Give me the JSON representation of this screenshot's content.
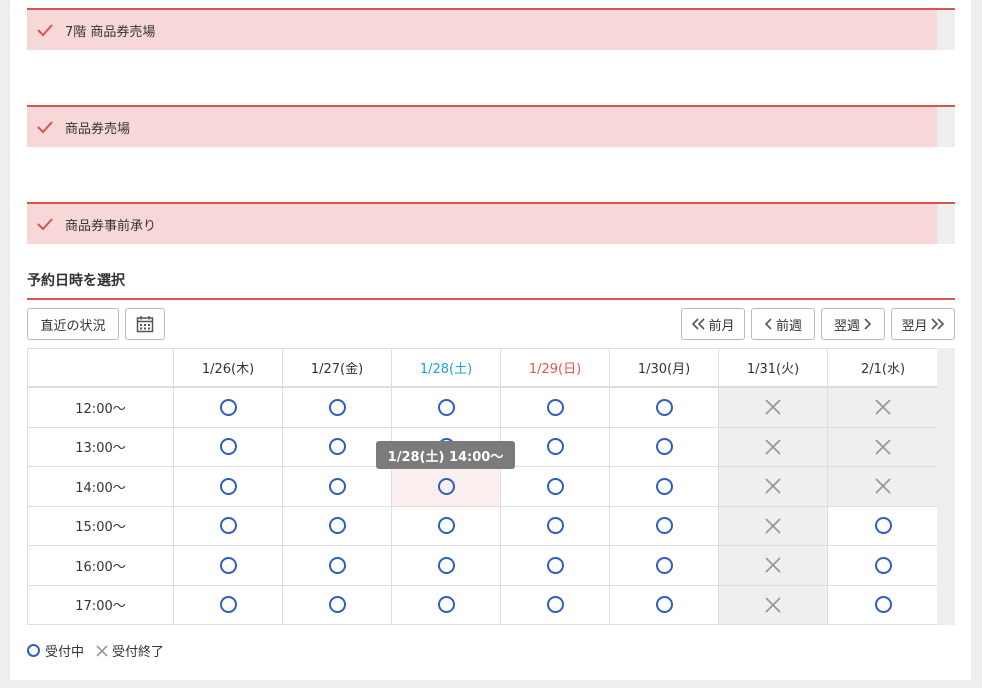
{
  "sections": [
    {
      "label": "7階 商品券売場"
    },
    {
      "label": "商品券売場"
    },
    {
      "label": "商品券事前承り"
    }
  ],
  "reservation": {
    "heading": "予約日時を選択",
    "recent_status_label": "直近の状況",
    "prev_month_label": "前月",
    "prev_week_label": "前週",
    "next_week_label": "翌週",
    "next_month_label": "翌月"
  },
  "days": [
    {
      "label": "1/26(木)",
      "color": "#333333"
    },
    {
      "label": "1/27(金)",
      "color": "#333333"
    },
    {
      "label": "1/28(土)",
      "color": "#1ba1d6"
    },
    {
      "label": "1/29(日)",
      "color": "#e2574c"
    },
    {
      "label": "1/30(月)",
      "color": "#333333"
    },
    {
      "label": "1/31(火)",
      "color": "#333333"
    },
    {
      "label": "2/1(水)",
      "color": "#333333"
    }
  ],
  "times": [
    "12:00〜",
    "13:00〜",
    "14:00〜",
    "15:00〜",
    "16:00〜",
    "17:00〜"
  ],
  "availability": [
    [
      "open",
      "open",
      "open",
      "open",
      "open",
      "closed",
      "closed"
    ],
    [
      "open",
      "open",
      "open",
      "open",
      "open",
      "closed",
      "closed"
    ],
    [
      "open",
      "open",
      "open",
      "open",
      "open",
      "closed",
      "closed"
    ],
    [
      "open",
      "open",
      "open",
      "open",
      "open",
      "closed",
      "open"
    ],
    [
      "open",
      "open",
      "open",
      "open",
      "open",
      "closed",
      "open"
    ],
    [
      "open",
      "open",
      "open",
      "open",
      "open",
      "closed",
      "open"
    ]
  ],
  "tooltip": {
    "text": "1/28(土) 14:00〜"
  },
  "legend": {
    "open_label": "受付中",
    "closed_label": "受付終了"
  },
  "colors": {
    "accent": "#d9534f",
    "section_bg": "#f8d7d9",
    "open": "#2f5fbd",
    "closed_mark": "#999999"
  }
}
